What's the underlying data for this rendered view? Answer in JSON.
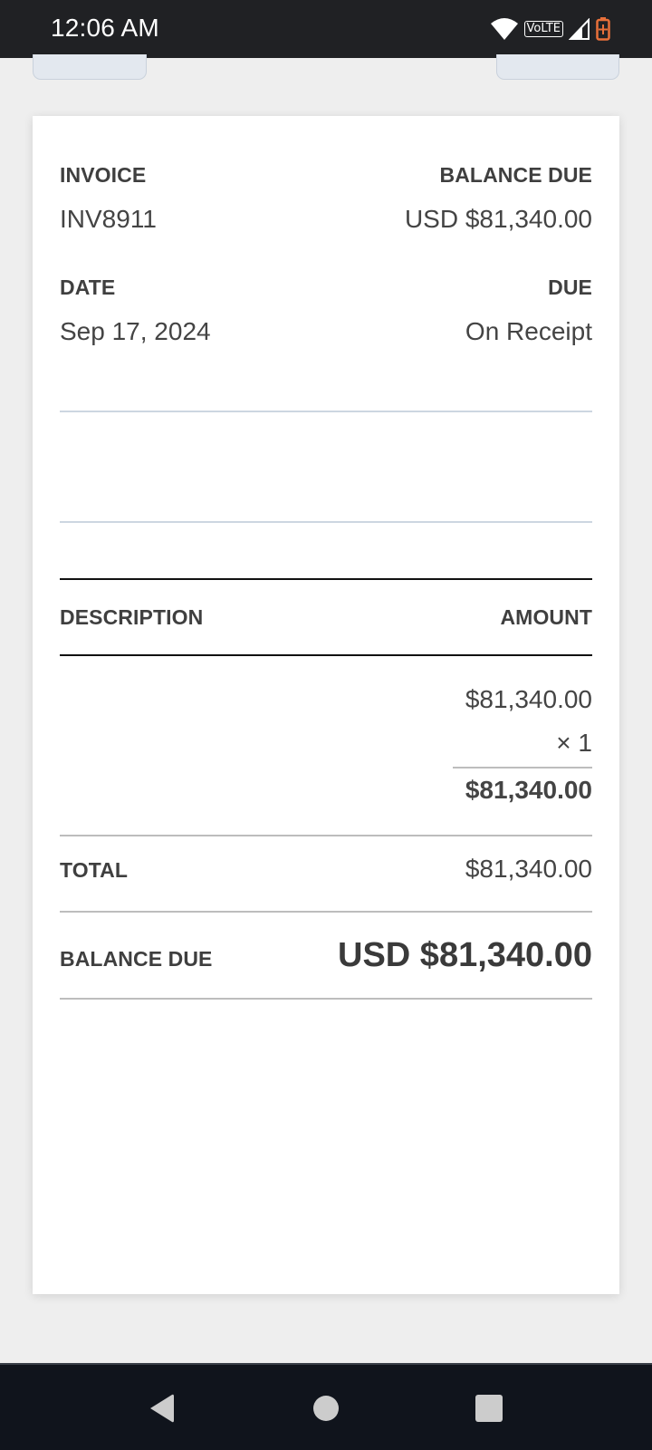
{
  "status_bar": {
    "time": "12:06 AM",
    "network_label": "VoLTE"
  },
  "invoice": {
    "invoice_label": "INVOICE",
    "invoice_number": "INV8911",
    "balance_due_label": "BALANCE DUE",
    "balance_due_value": "USD $81,340.00",
    "date_label": "DATE",
    "date_value": "Sep 17, 2024",
    "due_label": "DUE",
    "due_value": "On Receipt"
  },
  "table": {
    "description_header": "DESCRIPTION",
    "amount_header": "AMOUNT",
    "item": {
      "rate": "$81,340.00",
      "quantity": "× 1",
      "line_total": "$81,340.00"
    }
  },
  "totals": {
    "total_label": "TOTAL",
    "total_value": "$81,340.00",
    "balance_due_label": "BALANCE DUE",
    "balance_due_value": "USD $81,340.00"
  },
  "colors": {
    "battery_accent": "#e8703a",
    "status_bar_bg": "#202124",
    "nav_bar_bg": "#10141c"
  }
}
